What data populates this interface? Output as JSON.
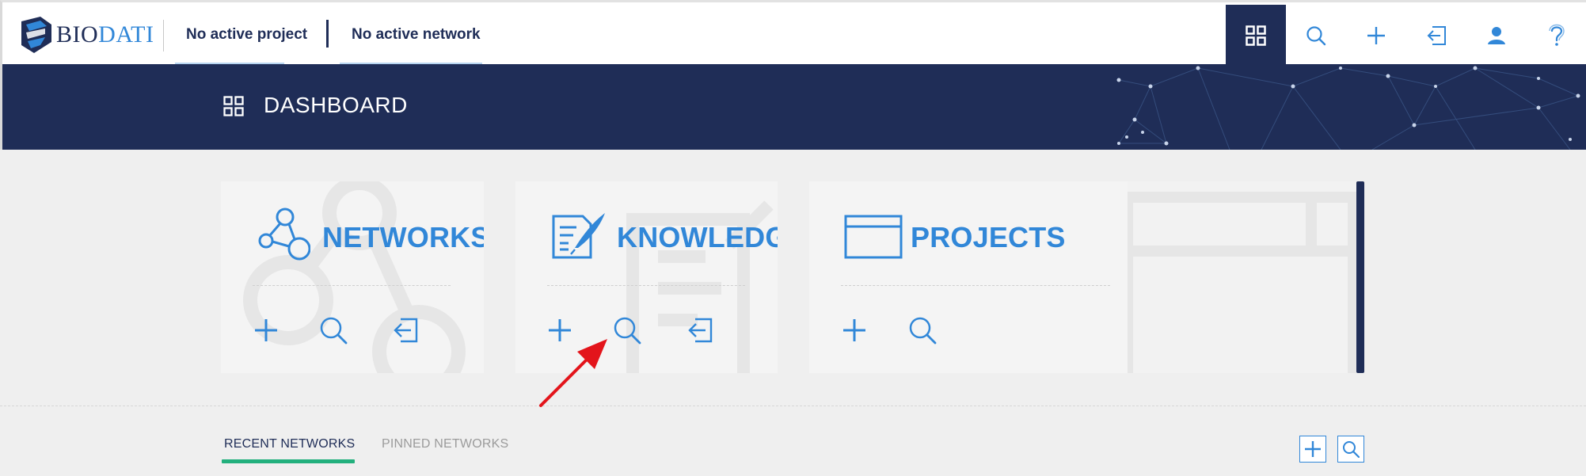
{
  "brand": {
    "name_part1": "BIO",
    "name_part2": "DATI"
  },
  "context": {
    "project": "No active project",
    "network": "No active network"
  },
  "nav": {
    "icons": [
      "dashboard-icon",
      "search-icon",
      "plus-icon",
      "import-icon",
      "user-icon",
      "help-icon"
    ],
    "active": "dashboard-icon"
  },
  "banner": {
    "title": "DASHBOARD"
  },
  "cards": [
    {
      "title": "NETWORKS",
      "actions": [
        "add",
        "search",
        "import"
      ]
    },
    {
      "title": "KNOWLEDGE",
      "actions": [
        "add",
        "search",
        "import"
      ]
    },
    {
      "title": "PROJECTS",
      "actions": [
        "add",
        "search"
      ]
    }
  ],
  "tabs": [
    {
      "label": "RECENT NETWORKS",
      "active": true
    },
    {
      "label": "PINNED NETWORKS",
      "active": false
    }
  ],
  "colors": {
    "navy": "#1f2d57",
    "accent_blue": "#3187d8",
    "tab_green": "#23b07d",
    "background": "#efefef",
    "pointer_red": "#e3141b"
  }
}
